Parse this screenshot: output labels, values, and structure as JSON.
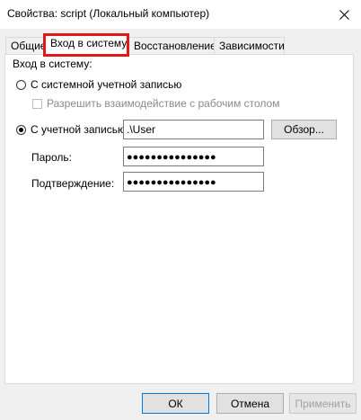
{
  "window": {
    "title": "Свойства: script (Локальный компьютер)",
    "close_icon": "close-icon"
  },
  "tabs": [
    {
      "label": "Общие",
      "active": false
    },
    {
      "label": "Вход в систему",
      "active": true,
      "highlighted": true
    },
    {
      "label": "Восстановление",
      "active": false
    },
    {
      "label": "Зависимости",
      "active": false
    }
  ],
  "logon": {
    "group_label": "Вход в систему:",
    "local_system_label": "С системной учетной записью",
    "local_system_selected": false,
    "desktop_interact_label": "Разрешить взаимодействие с рабочим столом",
    "desktop_interact_checked": false,
    "this_account_label": "С учетной записью:",
    "this_account_selected": true,
    "account_value": ".\\User",
    "browse_label": "Обзор...",
    "password_label": "Пароль:",
    "password_value": "●●●●●●●●●●●●●●●",
    "confirm_label": "Подтверждение:",
    "confirm_value": "●●●●●●●●●●●●●●●"
  },
  "buttons": {
    "ok": "ОК",
    "cancel": "Отмена",
    "apply": "Применить"
  },
  "colors": {
    "highlight": "#e01818",
    "default_button_border": "#0078d7"
  }
}
